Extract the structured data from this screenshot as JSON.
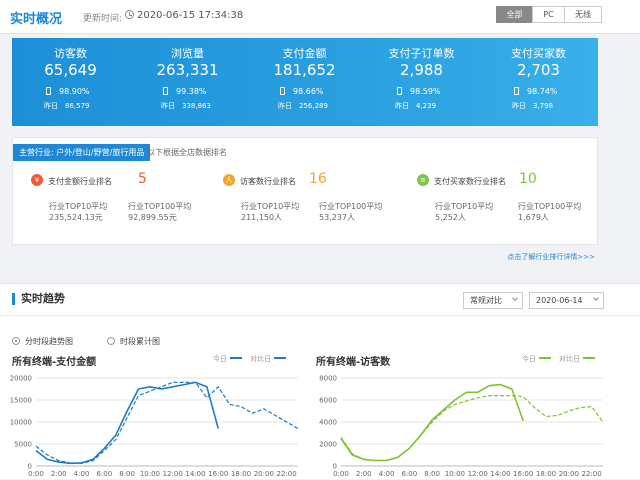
{
  "header": {
    "title": "实时概况",
    "update_label": "更新时间:",
    "update_time": "2020-06-15 17:34:38",
    "devices": [
      "全部",
      "PC",
      "无线"
    ]
  },
  "metrics": [
    {
      "name": "访客数",
      "value": "65,649",
      "pct": "98.90%",
      "yesterday_label": "昨日",
      "yesterday": "86,579"
    },
    {
      "name": "浏览量",
      "value": "263,331",
      "pct": "99.38%",
      "yesterday_label": "昨日",
      "yesterday": "338,863"
    },
    {
      "name": "支付金额",
      "value": "181,652",
      "pct": "98.66%",
      "yesterday_label": "昨日",
      "yesterday": "256,289"
    },
    {
      "name": "支付子订单数",
      "value": "2,988",
      "pct": "98.59%",
      "yesterday_label": "昨日",
      "yesterday": "4,239"
    },
    {
      "name": "支付买家数",
      "value": "2,703",
      "pct": "98.74%",
      "yesterday_label": "昨日",
      "yesterday": "3,798"
    }
  ],
  "ranking": {
    "industry": "主营行业: 户外/登山/野营/旅行用品",
    "note": "以下根据全店数据排名",
    "more_link": "点击了解行业排行详情>>>",
    "items": [
      {
        "icon": "¥",
        "icon_color": "#f05a3c",
        "label": "支付金额行业排名",
        "rank": "5",
        "rank_color": "#f05a3c",
        "c1_label": "行业TOP10平均",
        "c1_value": "235,524.13元",
        "c2_label": "行业TOP100平均",
        "c2_value": "92,899.55元"
      },
      {
        "icon": "人",
        "icon_color": "#f3a52b",
        "label": "访客数行业排名",
        "rank": "16",
        "rank_color": "#f3a52b",
        "c1_label": "行业TOP10平均",
        "c1_value": "211,150人",
        "c2_label": "行业TOP100平均",
        "c2_value": "53,237人"
      },
      {
        "icon": "≡",
        "icon_color": "#7fc44a",
        "label": "支付买家数行业排名",
        "rank": "10",
        "rank_color": "#7fc44a",
        "c1_label": "行业TOP10平均",
        "c1_value": "5,252人",
        "c2_label": "行业TOP100平均",
        "c2_value": "1,679人"
      }
    ]
  },
  "trend": {
    "title": "实时趋势",
    "compare_select": "常规对比",
    "date_select": "2020-06-14",
    "radio_options": [
      "分时段趋势图",
      "时段累计图"
    ],
    "selected_radio": 0
  },
  "chart_data": [
    {
      "type": "line",
      "title": "所有终端-支付金额",
      "legend": [
        "今日",
        "对比日"
      ],
      "color": "#1e7bc8",
      "x_ticks": [
        "0:00",
        "2:00",
        "4:00",
        "6:00",
        "8:00",
        "10:00",
        "12:00",
        "14:00",
        "16:00",
        "18:00",
        "20:00",
        "22:00"
      ],
      "y_ticks": [
        0,
        5000,
        10000,
        15000,
        20000
      ],
      "ylim": [
        0,
        20000
      ],
      "x": [
        0,
        1,
        2,
        3,
        4,
        5,
        6,
        7,
        8,
        9,
        10,
        11,
        12,
        13,
        14,
        15,
        16,
        17,
        18,
        19,
        20,
        21,
        22,
        23
      ],
      "series": [
        {
          "name": "今日",
          "dashed": false,
          "values": [
            3500,
            1500,
            900,
            600,
            700,
            1500,
            4000,
            7000,
            12500,
            17500,
            18000,
            17500,
            18000,
            18500,
            19000,
            18000,
            8500
          ]
        },
        {
          "name": "对比日",
          "dashed": true,
          "values": [
            4500,
            2500,
            1200,
            700,
            600,
            1200,
            3500,
            6000,
            11000,
            16000,
            17000,
            18000,
            19000,
            19000,
            19000,
            15500,
            18000,
            14000,
            13500,
            12000,
            13000,
            11500,
            10000,
            8500
          ]
        }
      ]
    },
    {
      "type": "line",
      "title": "所有终端-访客数",
      "legend": [
        "今日",
        "对比日"
      ],
      "color": "#7fc230",
      "x_ticks": [
        "0:00",
        "2:00",
        "4:00",
        "6:00",
        "8:00",
        "10:00",
        "12:00",
        "14:00",
        "16:00",
        "18:00",
        "20:00",
        "22:00"
      ],
      "y_ticks": [
        0,
        2000,
        4000,
        6000,
        8000
      ],
      "ylim": [
        0,
        8000
      ],
      "x": [
        0,
        1,
        2,
        3,
        4,
        5,
        6,
        7,
        8,
        9,
        10,
        11,
        12,
        13,
        14,
        15,
        16,
        17,
        18,
        19,
        20,
        21,
        22,
        23
      ],
      "series": [
        {
          "name": "今日",
          "dashed": false,
          "values": [
            2500,
            1000,
            600,
            500,
            500,
            800,
            1600,
            2800,
            4200,
            5100,
            6000,
            6700,
            6700,
            7300,
            7400,
            7000,
            4100
          ]
        },
        {
          "name": "对比日",
          "dashed": true,
          "values": [
            2600,
            1100,
            600,
            500,
            500,
            800,
            1600,
            2800,
            4000,
            5000,
            5600,
            5900,
            6200,
            6400,
            6400,
            6400,
            6300,
            5300,
            4500,
            4600,
            5000,
            5300,
            5400,
            4000
          ]
        }
      ]
    }
  ]
}
